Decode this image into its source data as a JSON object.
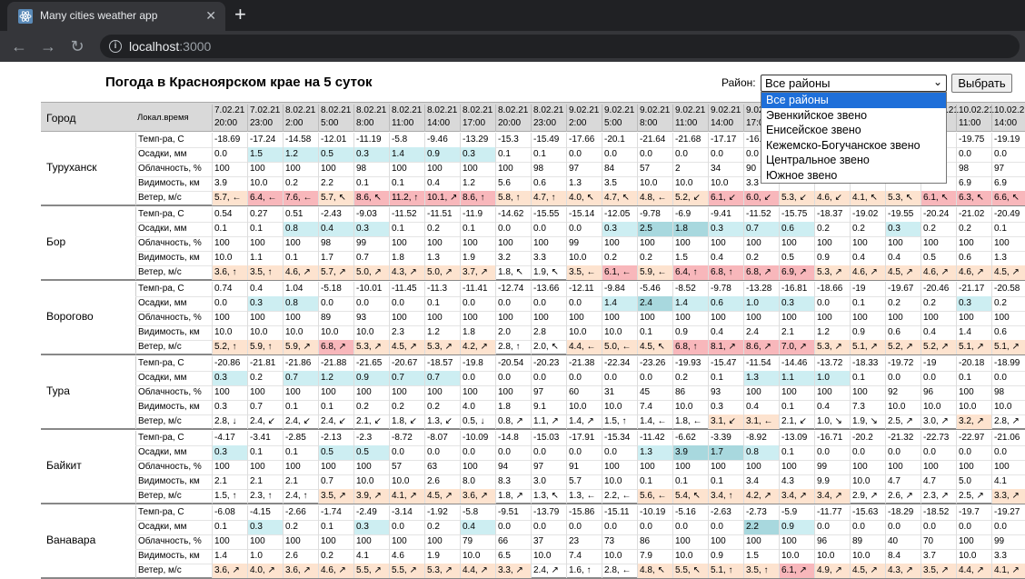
{
  "browser": {
    "tab_title": "Many cities weather app",
    "tab_close": "✕",
    "new_tab": "+",
    "url_host": "localhost",
    "url_port": ":3000"
  },
  "page": {
    "title": "Погода в Красноярском крае на 5 суток",
    "district_label": "Район:",
    "district_selected": "Все районы",
    "apply_label": "Выбрать",
    "district_options": [
      "Все районы",
      "Эвенкийское звено",
      "Енисейское звено",
      "Кежемско-Богучанское звено",
      "Центральное звено",
      "Южное звено"
    ]
  },
  "table": {
    "city_header": "Город",
    "local_time_header": "Локал.время",
    "param_labels": [
      "Темп-ра, С",
      "Осадки, мм",
      "Облачность, %",
      "Видимость, км",
      "Ветер, м/с"
    ],
    "times": [
      "7.02.21 20:00",
      "7.02.21 23:00",
      "8.02.21 2:00",
      "8.02.21 5:00",
      "8.02.21 8:00",
      "8.02.21 11:00",
      "8.02.21 14:00",
      "8.02.21 17:00",
      "8.02.21 20:00",
      "8.02.21 23:00",
      "9.02.21 2:00",
      "9.02.21 5:00",
      "9.02.21 8:00",
      "9.02.21 11:00",
      "9.02.21 14:00",
      "9.02.21 17:00",
      "9.02.21 20:00",
      "9.02.21 23:00",
      "10.02.21 2:00",
      "10.02.21 5:00",
      "10.02.21 8:00",
      "10.02.21 11:00",
      "10.02.21 14:00"
    ],
    "cities": [
      {
        "name": "Туруханск",
        "temp": [
          "-18.69",
          "-17.24",
          "-14.58",
          "-12.01",
          "-11.19",
          "-5.8",
          "-9.46",
          "-13.29",
          "-15.3",
          "-15.49",
          "-17.66",
          "-20.1",
          "-21.64",
          "-21.68",
          "-17.17",
          "-16.",
          "",
          "",
          "",
          "",
          "",
          "-19.75",
          "-19.19"
        ],
        "precip": [
          "0.0",
          "1.5",
          "1.2",
          "0.5",
          "0.3",
          "1.4",
          "0.9",
          "0.3",
          "0.1",
          "0.1",
          "0.0",
          "0.0",
          "0.0",
          "0.0",
          "0.0",
          "0.0",
          "",
          "",
          "",
          "",
          "",
          "0.0",
          "0.0"
        ],
        "cloud": [
          "100",
          "100",
          "100",
          "100",
          "98",
          "100",
          "100",
          "100",
          "100",
          "98",
          "97",
          "84",
          "57",
          "2",
          "34",
          "90",
          "",
          "",
          "",
          "",
          "",
          "98",
          "97"
        ],
        "vis": [
          "3.9",
          "10.0",
          "0.2",
          "2.2",
          "0.1",
          "0.1",
          "0.4",
          "1.2",
          "5.6",
          "0.6",
          "1.3",
          "3.5",
          "10.0",
          "10.0",
          "10.0",
          "3.3",
          "",
          "",
          "",
          "",
          "",
          "6.9",
          "6.9"
        ],
        "wind": [
          "5.7, ←",
          "6.4, ←",
          "7.6, ←",
          "5.7, ↖",
          "8.6, ↖",
          "11.2, ↑",
          "10.1, ↗",
          "8.6, ↑",
          "5.8, ↑",
          "4.7, ↑",
          "4.0, ↖",
          "4.7, ↖",
          "4.8, ←",
          "5.2, ↙",
          "6.1, ↙",
          "6.0, ↙",
          "5.3, ↙",
          "4.6, ↙",
          "4.1, ↖",
          "5.3, ↖",
          "6.1, ↖",
          "6.3, ↖",
          "6.6, ↖"
        ],
        "precip_hl": [
          0,
          1,
          1,
          1,
          1,
          1,
          1,
          1,
          0,
          0,
          0,
          0,
          0,
          0,
          0,
          0,
          0,
          0,
          0,
          0,
          0,
          0,
          0
        ],
        "wind_hl": [
          1,
          2,
          2,
          1,
          2,
          2,
          2,
          2,
          1,
          1,
          1,
          1,
          1,
          1,
          2,
          2,
          1,
          1,
          1,
          1,
          2,
          2,
          2
        ]
      },
      {
        "name": "Бор",
        "temp": [
          "0.54",
          "0.27",
          "0.51",
          "-2.43",
          "-9.03",
          "-11.52",
          "-11.51",
          "-11.9",
          "-14.62",
          "-15.55",
          "-15.14",
          "-12.05",
          "-9.78",
          "-6.9",
          "-9.41",
          "-11.52",
          "-15.75",
          "-18.37",
          "-19.02",
          "-19.55",
          "-20.24",
          "-21.02",
          "-20.49"
        ],
        "precip": [
          "0.1",
          "0.1",
          "0.8",
          "0.4",
          "0.3",
          "0.1",
          "0.2",
          "0.1",
          "0.0",
          "0.0",
          "0.0",
          "0.3",
          "2.5",
          "1.8",
          "0.3",
          "0.7",
          "0.6",
          "0.2",
          "0.2",
          "0.3",
          "0.2",
          "0.2",
          "0.1"
        ],
        "cloud": [
          "100",
          "100",
          "100",
          "98",
          "99",
          "100",
          "100",
          "100",
          "100",
          "100",
          "99",
          "100",
          "100",
          "100",
          "100",
          "100",
          "100",
          "100",
          "100",
          "100",
          "100",
          "100",
          "100"
        ],
        "vis": [
          "10.0",
          "1.1",
          "0.1",
          "1.7",
          "0.7",
          "1.8",
          "1.3",
          "1.9",
          "3.2",
          "3.3",
          "10.0",
          "0.2",
          "0.2",
          "1.5",
          "0.4",
          "0.2",
          "0.5",
          "0.9",
          "0.4",
          "0.4",
          "0.5",
          "0.6",
          "1.3"
        ],
        "wind": [
          "3.6, ↑",
          "3.5, ↑",
          "4.6, ↗",
          "5.7, ↗",
          "5.0, ↗",
          "4.3, ↗",
          "5.0, ↗",
          "3.7, ↗",
          "1.8, ↖",
          "1.9, ↖",
          "3.5, ←",
          "6.1, ←",
          "5.9, ←",
          "6.4, ↑",
          "6.8, ↑",
          "6.8, ↗",
          "6.9, ↗",
          "5.3, ↗",
          "4.6, ↗",
          "4.5, ↗",
          "4.6, ↗",
          "4.6, ↗",
          "4.5, ↗"
        ],
        "precip_hl": [
          0,
          0,
          1,
          1,
          1,
          0,
          0,
          0,
          0,
          0,
          0,
          1,
          2,
          2,
          1,
          1,
          1,
          0,
          0,
          1,
          0,
          0,
          0
        ],
        "wind_hl": [
          1,
          1,
          1,
          1,
          1,
          1,
          1,
          1,
          0,
          0,
          1,
          2,
          1,
          2,
          2,
          2,
          2,
          1,
          1,
          1,
          1,
          1,
          1
        ]
      },
      {
        "name": "Ворогово",
        "temp": [
          "0.74",
          "0.4",
          "1.04",
          "-5.18",
          "-10.01",
          "-11.45",
          "-11.3",
          "-11.41",
          "-12.74",
          "-13.66",
          "-12.11",
          "-9.84",
          "-5.46",
          "-8.52",
          "-9.78",
          "-13.28",
          "-16.81",
          "-18.66",
          "-19",
          "-19.67",
          "-20.46",
          "-21.17",
          "-20.58"
        ],
        "precip": [
          "0.0",
          "0.3",
          "0.8",
          "0.0",
          "0.0",
          "0.0",
          "0.1",
          "0.0",
          "0.0",
          "0.0",
          "0.0",
          "1.4",
          "2.4",
          "1.4",
          "0.6",
          "1.0",
          "0.3",
          "0.0",
          "0.1",
          "0.2",
          "0.2",
          "0.3",
          "0.2"
        ],
        "cloud": [
          "100",
          "100",
          "100",
          "89",
          "93",
          "100",
          "100",
          "100",
          "100",
          "100",
          "100",
          "100",
          "100",
          "100",
          "100",
          "100",
          "100",
          "100",
          "100",
          "100",
          "100",
          "100",
          "100"
        ],
        "vis": [
          "10.0",
          "10.0",
          "10.0",
          "10.0",
          "10.0",
          "2.3",
          "1.2",
          "1.8",
          "2.0",
          "2.8",
          "10.0",
          "10.0",
          "0.1",
          "0.9",
          "0.4",
          "2.4",
          "2.1",
          "1.2",
          "0.9",
          "0.6",
          "0.4",
          "1.4",
          "0.6"
        ],
        "wind": [
          "5.2, ↑",
          "5.9, ↑",
          "5.9, ↗",
          "6.8, ↗",
          "5.3, ↗",
          "4.5, ↗",
          "5.3, ↗",
          "4.2, ↗",
          "2.8, ↑",
          "2.0, ↖",
          "4.4, ←",
          "5.0, ←",
          "4.5, ↖",
          "6.8, ↑",
          "8.1, ↗",
          "8.6, ↗",
          "7.0, ↗",
          "5.3, ↗",
          "5.1, ↗",
          "5.2, ↗",
          "5.2, ↗",
          "5.1, ↗",
          "5.1, ↗"
        ],
        "precip_hl": [
          0,
          1,
          1,
          0,
          0,
          0,
          0,
          0,
          0,
          0,
          0,
          1,
          2,
          1,
          1,
          1,
          1,
          0,
          0,
          0,
          0,
          1,
          0
        ],
        "wind_hl": [
          1,
          1,
          1,
          2,
          1,
          1,
          1,
          1,
          0,
          0,
          1,
          1,
          1,
          2,
          2,
          2,
          2,
          1,
          1,
          1,
          1,
          1,
          1
        ]
      },
      {
        "name": "Тура",
        "temp": [
          "-20.86",
          "-21.81",
          "-21.86",
          "-21.88",
          "-21.65",
          "-20.67",
          "-18.57",
          "-19.8",
          "-20.54",
          "-20.23",
          "-21.38",
          "-22.34",
          "-23.26",
          "-19.93",
          "-15.47",
          "-11.54",
          "-14.46",
          "-13.72",
          "-18.33",
          "-19.72",
          "-19",
          "-20.18",
          "-18.99"
        ],
        "precip": [
          "0.3",
          "0.2",
          "0.7",
          "1.2",
          "0.9",
          "0.7",
          "0.7",
          "0.0",
          "0.0",
          "0.0",
          "0.0",
          "0.0",
          "0.0",
          "0.2",
          "0.1",
          "1.3",
          "1.1",
          "1.0",
          "0.1",
          "0.0",
          "0.0",
          "0.1",
          "0.0"
        ],
        "cloud": [
          "100",
          "100",
          "100",
          "100",
          "100",
          "100",
          "100",
          "100",
          "100",
          "97",
          "60",
          "31",
          "45",
          "86",
          "93",
          "100",
          "100",
          "100",
          "100",
          "92",
          "96",
          "100",
          "98"
        ],
        "vis": [
          "0.3",
          "0.7",
          "0.1",
          "0.1",
          "0.2",
          "0.2",
          "0.2",
          "4.0",
          "1.8",
          "9.1",
          "10.0",
          "10.0",
          "7.4",
          "10.0",
          "0.3",
          "0.4",
          "0.1",
          "0.4",
          "7.3",
          "10.0",
          "10.0",
          "10.0",
          "10.0"
        ],
        "wind": [
          "2.8, ↓",
          "2.4, ↙",
          "2.4, ↙",
          "2.4, ↙",
          "2.1, ↙",
          "1.8, ↙",
          "1.3, ↙",
          "0.5, ↓",
          "0.8, ↗",
          "1.1, ↗",
          "1.4, ↗",
          "1.5, ↑",
          "1.4, ←",
          "1.8, ←",
          "3.1, ↙",
          "3.1, ←",
          "2.1, ↙",
          "1.0, ↘",
          "1.9, ↘",
          "2.5, ↗",
          "3.0, ↗",
          "3.2, ↗",
          "2.8, ↗"
        ],
        "precip_hl": [
          1,
          0,
          1,
          1,
          1,
          1,
          1,
          0,
          0,
          0,
          0,
          0,
          0,
          0,
          0,
          1,
          1,
          1,
          0,
          0,
          0,
          0,
          0
        ],
        "wind_hl": [
          0,
          0,
          0,
          0,
          0,
          0,
          0,
          0,
          0,
          0,
          0,
          0,
          0,
          0,
          1,
          1,
          0,
          0,
          0,
          0,
          0,
          1,
          0
        ]
      },
      {
        "name": "Байкит",
        "temp": [
          "-4.17",
          "-3.41",
          "-2.85",
          "-2.13",
          "-2.3",
          "-8.72",
          "-8.07",
          "-10.09",
          "-14.8",
          "-15.03",
          "-17.91",
          "-15.34",
          "-11.42",
          "-6.62",
          "-3.39",
          "-8.92",
          "-13.09",
          "-16.71",
          "-20.2",
          "-21.32",
          "-22.73",
          "-22.97",
          "-21.06"
        ],
        "precip": [
          "0.3",
          "0.1",
          "0.1",
          "0.5",
          "0.5",
          "0.0",
          "0.0",
          "0.0",
          "0.0",
          "0.0",
          "0.0",
          "0.0",
          "1.3",
          "3.9",
          "1.7",
          "0.8",
          "0.1",
          "0.0",
          "0.0",
          "0.0",
          "0.0",
          "0.0",
          "0.0"
        ],
        "cloud": [
          "100",
          "100",
          "100",
          "100",
          "100",
          "57",
          "63",
          "100",
          "94",
          "97",
          "91",
          "100",
          "100",
          "100",
          "100",
          "100",
          "100",
          "99",
          "100",
          "100",
          "100",
          "100",
          "100"
        ],
        "vis": [
          "2.1",
          "2.1",
          "2.1",
          "0.7",
          "10.0",
          "10.0",
          "2.6",
          "8.0",
          "8.3",
          "3.0",
          "5.7",
          "10.0",
          "0.1",
          "0.1",
          "0.1",
          "3.4",
          "4.3",
          "9.9",
          "10.0",
          "4.7",
          "4.7",
          "5.0",
          "4.1"
        ],
        "wind": [
          "1.5, ↑",
          "2.3, ↑",
          "2.4, ↑",
          "3.5, ↗",
          "3.9, ↗",
          "4.1, ↗",
          "4.5, ↗",
          "3.6, ↗",
          "1.8, ↗",
          "1.3, ↖",
          "1.3, ←",
          "2.2, ←",
          "5.6, ←",
          "5.4, ↖",
          "3.4, ↑",
          "4.2, ↗",
          "3.4, ↗",
          "3.4, ↗",
          "2.9, ↗",
          "2.6, ↗",
          "2.3, ↗",
          "2.5, ↗",
          "3.3, ↗"
        ],
        "precip_hl": [
          1,
          0,
          0,
          1,
          1,
          0,
          0,
          0,
          0,
          0,
          0,
          0,
          1,
          2,
          2,
          1,
          0,
          0,
          0,
          0,
          0,
          0,
          0
        ],
        "wind_hl": [
          0,
          0,
          0,
          1,
          1,
          1,
          1,
          1,
          0,
          0,
          0,
          0,
          1,
          1,
          1,
          1,
          1,
          1,
          0,
          0,
          0,
          0,
          1
        ]
      },
      {
        "name": "Ванавара",
        "temp": [
          "-6.08",
          "-4.15",
          "-2.66",
          "-1.74",
          "-2.49",
          "-3.14",
          "-1.92",
          "-5.8",
          "-9.51",
          "-13.79",
          "-15.86",
          "-15.11",
          "-10.19",
          "-5.16",
          "-2.63",
          "-2.73",
          "-5.9",
          "-11.77",
          "-15.63",
          "-18.29",
          "-18.52",
          "-19.7",
          "-19.27"
        ],
        "precip": [
          "0.1",
          "0.3",
          "0.2",
          "0.1",
          "0.3",
          "0.0",
          "0.2",
          "0.4",
          "0.0",
          "0.0",
          "0.0",
          "0.0",
          "0.0",
          "0.0",
          "0.0",
          "2.2",
          "0.9",
          "0.0",
          "0.0",
          "0.0",
          "0.0",
          "0.0",
          "0.0"
        ],
        "cloud": [
          "100",
          "100",
          "100",
          "100",
          "100",
          "100",
          "100",
          "79",
          "66",
          "37",
          "23",
          "73",
          "86",
          "100",
          "100",
          "100",
          "100",
          "96",
          "89",
          "40",
          "70",
          "100",
          "99"
        ],
        "vis": [
          "1.4",
          "1.0",
          "2.6",
          "0.2",
          "4.1",
          "4.6",
          "1.9",
          "10.0",
          "6.5",
          "10.0",
          "7.4",
          "10.0",
          "7.9",
          "10.0",
          "0.9",
          "1.5",
          "10.0",
          "10.0",
          "10.0",
          "8.4",
          "3.7",
          "10.0",
          "3.3"
        ],
        "wind": [
          "3.6, ↗",
          "4.0, ↗",
          "3.6, ↗",
          "4.6, ↗",
          "5.5, ↗",
          "5.5, ↗",
          "5.3, ↗",
          "4.4, ↗",
          "3.3, ↗",
          "2.4, ↗",
          "1.6, ↑",
          "2.8, ←",
          "4.8, ↖",
          "5.5, ↖",
          "5.1, ↑",
          "3.5, ↑",
          "6.1, ↗",
          "4.9, ↗",
          "4.5, ↗",
          "4.3, ↗",
          "3.5, ↗",
          "4.4, ↗",
          "4.1, ↗"
        ],
        "precip_hl": [
          0,
          1,
          0,
          0,
          1,
          0,
          0,
          1,
          0,
          0,
          0,
          0,
          0,
          0,
          0,
          2,
          1,
          0,
          0,
          0,
          0,
          0,
          0
        ],
        "wind_hl": [
          1,
          1,
          1,
          1,
          1,
          1,
          1,
          1,
          1,
          0,
          0,
          0,
          1,
          1,
          1,
          1,
          2,
          1,
          1,
          1,
          1,
          1,
          1
        ]
      }
    ]
  }
}
